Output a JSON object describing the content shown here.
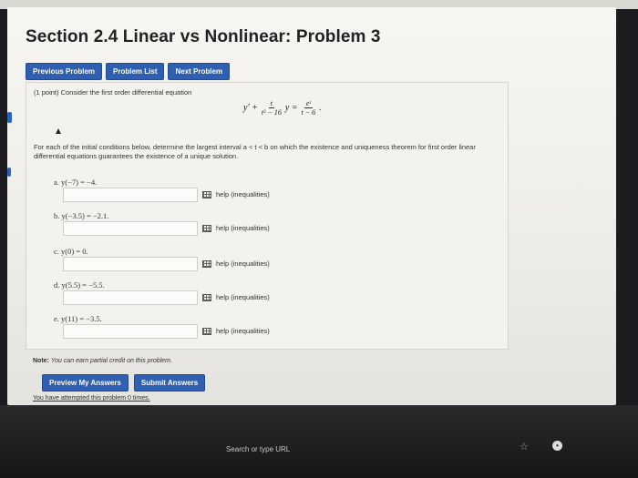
{
  "page": {
    "title": "Section 2.4 Linear vs Nonlinear: Problem 3"
  },
  "nav": {
    "previous_label": "Previous Problem",
    "list_label": "Problem List",
    "next_label": "Next Problem"
  },
  "problem": {
    "intro": "(1 point) Consider the first order differential equation",
    "equation": {
      "lhs_prefix": "y' +",
      "frac1_num": "t",
      "frac1_den": "t² − 16",
      "mid": "y =",
      "frac2_num": "eᵗ",
      "frac2_den": "t − 6",
      "end": "."
    },
    "description": "For each of the initial conditions below, determine the largest interval a < t < b on which the existence and uniqueness theorem for first order linear differential equations guarantees the existence of a unique solution.",
    "parts": [
      {
        "label": "a. y(−7) = −4.",
        "value": "",
        "help": "help (inequalities)"
      },
      {
        "label": "b. y(−3.5) = −2.1.",
        "value": "",
        "help": "help (inequalities)"
      },
      {
        "label": "c. y(0) = 0.",
        "value": "",
        "help": "help (inequalities)"
      },
      {
        "label": "d. y(5.5) = −5.5.",
        "value": "",
        "help": "help (inequalities)"
      },
      {
        "label": "e. y(11) = −3.5.",
        "value": "",
        "help": "help (inequalities)"
      }
    ]
  },
  "footer": {
    "note_bold": "Note:",
    "note_text": "You can earn partial credit on this problem.",
    "preview_label": "Preview My Answers",
    "submit_label": "Submit Answers",
    "attempts_text": "You have attempted this problem 0 times."
  },
  "browser": {
    "address_text": "Search or type URL"
  },
  "icons": [
    "grid-icon",
    "star-icon",
    "extension-icon"
  ],
  "colors": {
    "button_bg": "#2f5fb0",
    "accent_marker": "#2b63c0"
  }
}
